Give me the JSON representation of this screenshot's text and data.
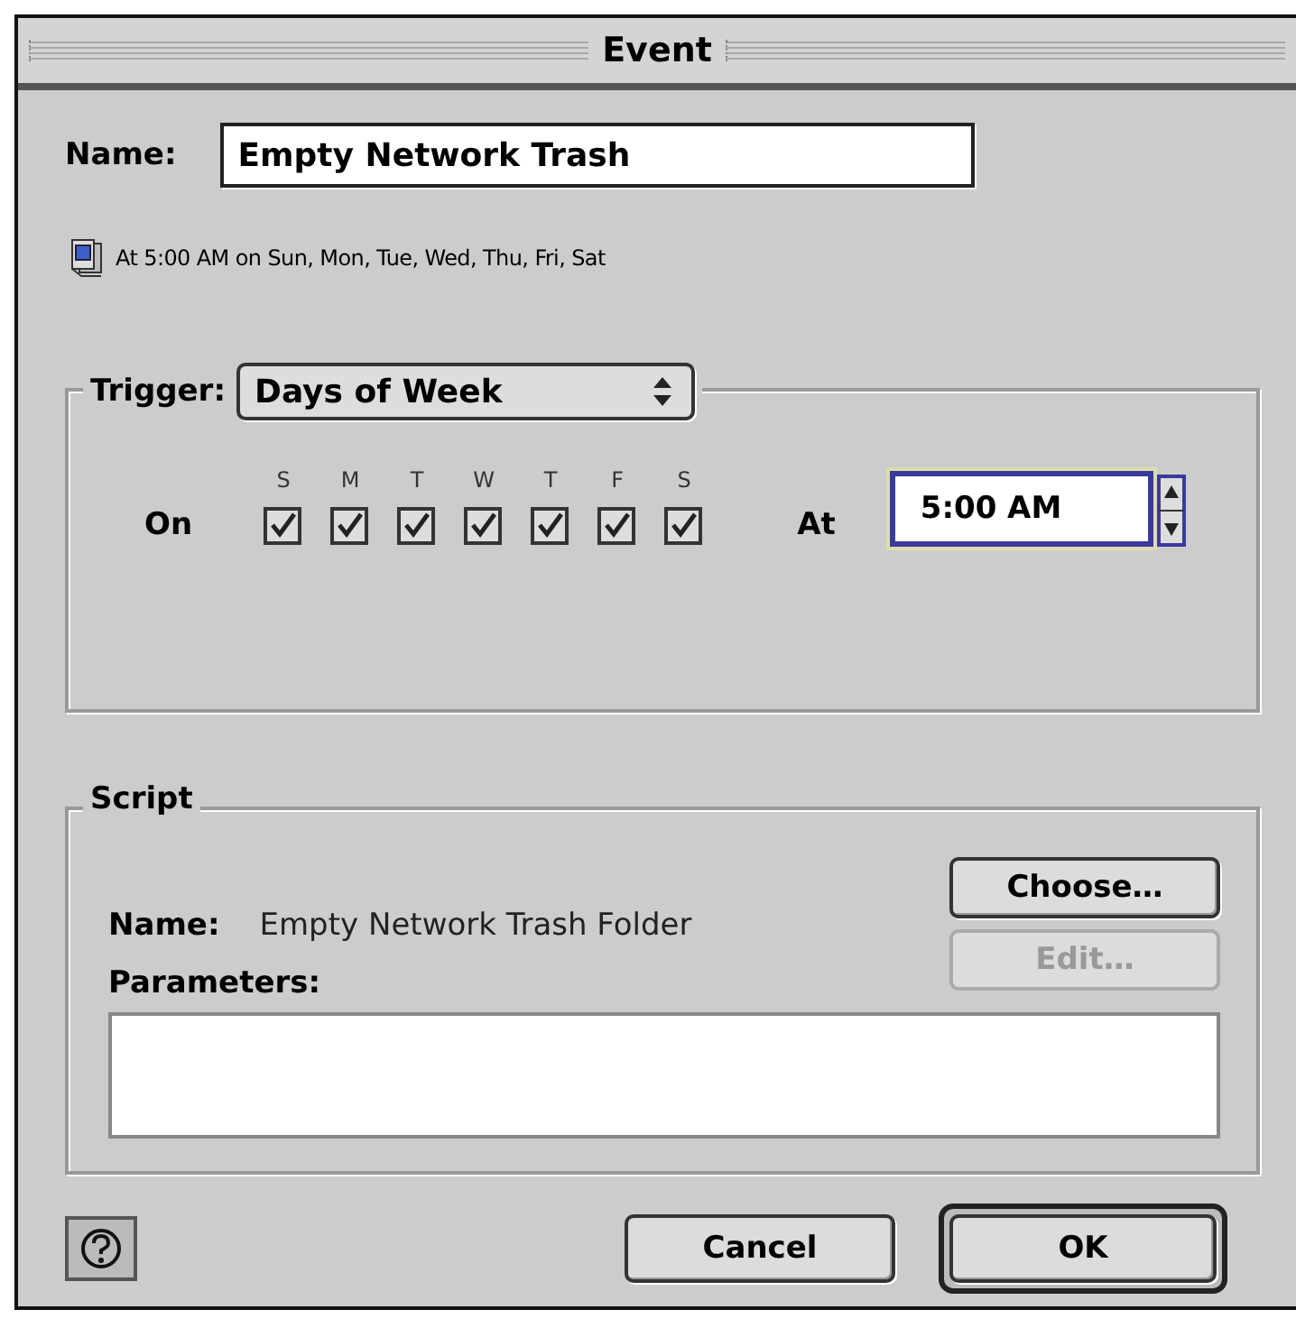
{
  "window": {
    "title": "Event"
  },
  "name_field": {
    "label": "Name:",
    "value": "Empty Network Trash"
  },
  "summary": "At 5:00 AM on Sun, Mon, Tue, Wed, Thu, Fri, Sat",
  "trigger": {
    "label": "Trigger:",
    "popup": "Days of Week",
    "on_label": "On",
    "at_label": "At",
    "time": "5:00 AM",
    "days": [
      {
        "letter": "S",
        "checked": true
      },
      {
        "letter": "M",
        "checked": true
      },
      {
        "letter": "T",
        "checked": true
      },
      {
        "letter": "W",
        "checked": true
      },
      {
        "letter": "T",
        "checked": true
      },
      {
        "letter": "F",
        "checked": true
      },
      {
        "letter": "S",
        "checked": true
      }
    ]
  },
  "script": {
    "title": "Script",
    "name_label": "Name:",
    "name": "Empty Network Trash Folder",
    "parameters_label": "Parameters:",
    "buttons": [
      {
        "label": "Choose…",
        "disabled": false
      },
      {
        "label": "Edit…",
        "disabled": true
      }
    ]
  },
  "buttons": [
    {
      "label": "Cancel",
      "default": false
    },
    {
      "label": "OK",
      "default": true
    }
  ]
}
